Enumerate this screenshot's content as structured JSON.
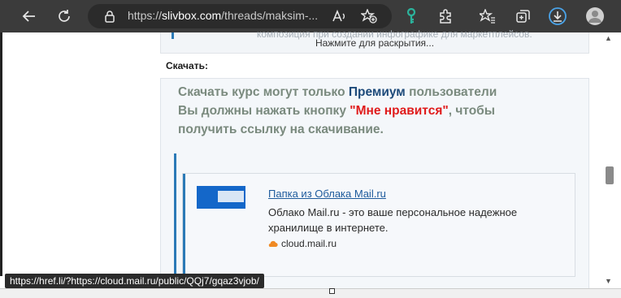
{
  "browser": {
    "url_prefix": "https://",
    "url_host": "slivbox.com",
    "url_rest": "/threads/maksim-...",
    "status_url": "https://href.li/?https://cloud.mail.ru/public/QQj7/gqaz3vjob/"
  },
  "icons": {
    "back": "back-arrow-icon",
    "refresh": "refresh-icon",
    "lock": "lock-icon",
    "read_aloud": "read-aloud-icon",
    "add_favorite": "add-favorite-icon",
    "key": "key-icon",
    "extensions": "puzzle-icon",
    "favorites": "favorites-icon",
    "collections": "collections-icon",
    "downloads": "download-icon",
    "profile": "profile-icon"
  },
  "post": {
    "faded_line": "композиция при создании инфографике для маркетплейсов.",
    "expand_label": "Нажмите для раскрытия...",
    "download_label": "Скачать:"
  },
  "premium": {
    "line1_a": "Скачать курс могут только ",
    "line1_b": "Премиум",
    "line1_c": " пользователи",
    "line2_a": "Вы должны нажать кнопку ",
    "line2_b": "\"Мне нравится\"",
    "line2_c": ", чтобы",
    "line3": "получить ссылку на скачивание."
  },
  "card": {
    "title": "Папка из Облака Mail.ru",
    "desc": "Облако Mail.ru - это ваше персональное надежное хранилище в интернете.",
    "site": "cloud.mail.ru"
  },
  "colors": {
    "accent": "#2b7ab7",
    "premium": "#1d4a7a",
    "like": "#e01b1b",
    "key_icon": "#2bb39c"
  }
}
